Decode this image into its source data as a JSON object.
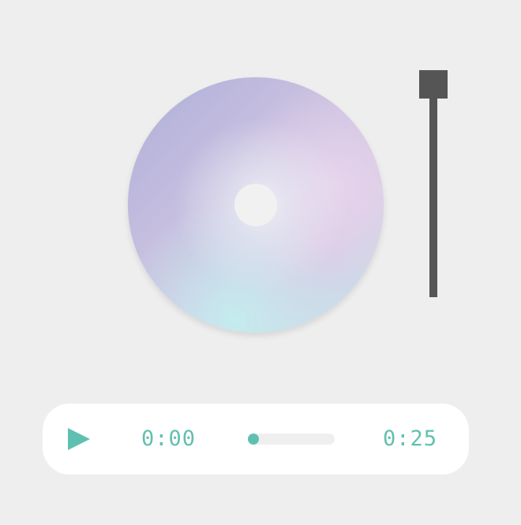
{
  "player": {
    "current_time": "0:00",
    "total_time": "0:25",
    "progress": 0.0,
    "accent_color": "#5fc0b2",
    "play_icon": "play-icon"
  },
  "turntable": {
    "disc_icon": "disc",
    "arm_color": "#555555"
  }
}
